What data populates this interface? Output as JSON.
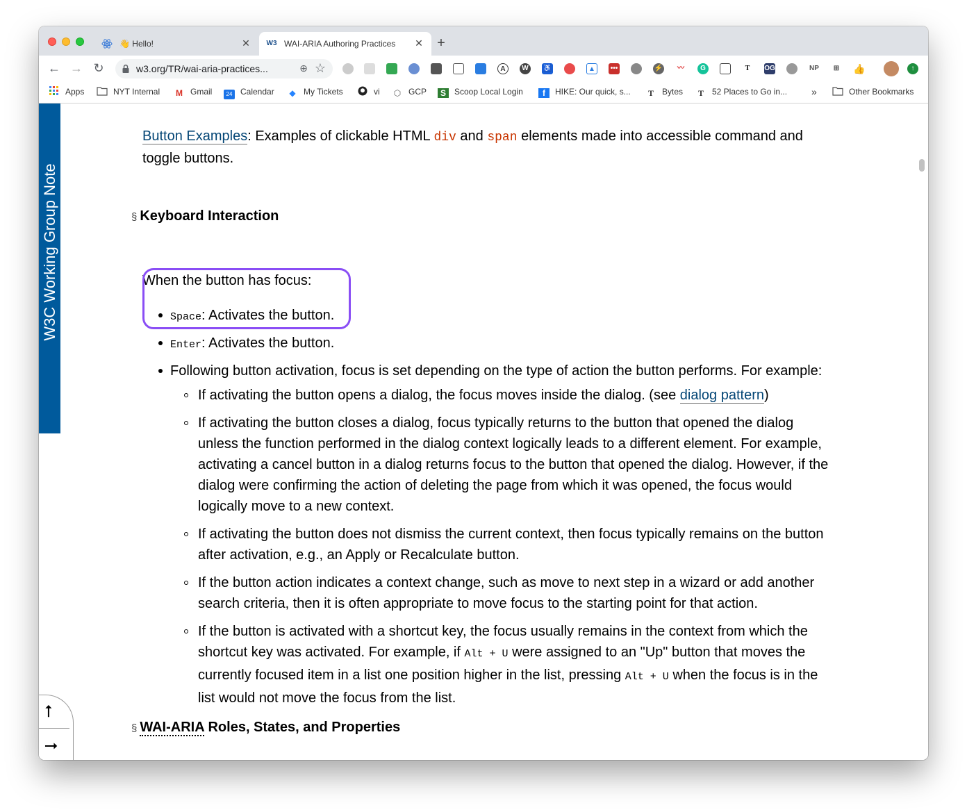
{
  "browser": {
    "tabs": [
      {
        "title": "👋 Hello!",
        "favicon": "react-atom-icon",
        "active": false
      },
      {
        "title": "WAI-ARIA Authoring Practices",
        "favicon": "w3c-icon",
        "active": true
      }
    ],
    "new_tab_label": "+",
    "url": "w3.org/TR/wai-aria-practices...",
    "bookmarks": [
      {
        "label": "Apps",
        "icon": "apps-grid-icon"
      },
      {
        "label": "NYT Internal",
        "icon": "folder-icon"
      },
      {
        "label": "Gmail",
        "icon": "gmail-icon"
      },
      {
        "label": "Calendar",
        "icon": "calendar-icon"
      },
      {
        "label": "My Tickets",
        "icon": "jira-icon"
      },
      {
        "label": "vi",
        "icon": "github-icon"
      },
      {
        "label": "GCP",
        "icon": "gcp-icon"
      },
      {
        "label": "Scoop Local Login",
        "icon": "scoop-icon"
      },
      {
        "label": "HIKE: Our quick, s...",
        "icon": "facebook-icon"
      },
      {
        "label": "Bytes",
        "icon": "nyt-icon"
      },
      {
        "label": "52 Places to Go in...",
        "icon": "nyt-icon"
      },
      {
        "label": "»",
        "icon": ""
      },
      {
        "label": "Other Bookmarks",
        "icon": "folder-icon"
      }
    ],
    "calendar_day": "24"
  },
  "page": {
    "banner": "W3C Working Group Note",
    "button_examples": {
      "link": "Button Examples",
      "text1": ": Examples of clickable HTML ",
      "code1": "div",
      "text2": " and ",
      "code2": "span",
      "text3": " elements made into accessible command and",
      "line2": "toggle buttons."
    },
    "keyboard_heading": "Keyboard Interaction",
    "section_mark": "§",
    "intro": "When the button has focus:",
    "items": [
      {
        "key": "Space",
        "text": ": Activates the button."
      },
      {
        "key": "Enter",
        "text": ": Activates the button."
      }
    ],
    "following": "Following button activation, focus is set depending on the type of action the button performs. For example:",
    "sub1": {
      "text": "If activating the button opens a dialog, the focus moves inside the dialog. (see ",
      "link": "dialog pattern",
      "end": ")"
    },
    "sub2": [
      "If activating the button closes a dialog, focus typically returns to the button that opened the dialog",
      "unless the function performed in the dialog context logically leads to a different element. For example,",
      "activating a cancel button in a dialog returns focus to the button that opened the dialog. However, if the",
      "dialog were confirming the action of deleting the page from which it was opened, the focus would",
      "logically move to a new context."
    ],
    "sub3": [
      "If activating the button does not dismiss the current context, then focus typically remains on the button",
      "after activation, e.g., an Apply or Recalculate button."
    ],
    "sub4": [
      "If the button action indicates a context change, such as move to next step in a wizard or add another",
      "search criteria, then it is often appropriate to move focus to the starting point for that action."
    ],
    "sub5": {
      "line1": "If the button is activated with a shortcut key, the focus usually remains in the context from which the",
      "line2a": "shortcut key was activated. For example, if ",
      "code_a": "Alt + U",
      "line2b": " were assigned to an \"Up\" button that moves the",
      "line3a": "currently focused item in a list one position higher in the list, pressing ",
      "code_b": "Alt + U",
      "line3b": " when the focus is in the",
      "line4": "list would not move the focus from the list."
    },
    "roles_heading_abbr": "WAI-ARIA",
    "roles_heading_rest": " Roles, States, and Properties"
  },
  "colors": {
    "banner": "#005a9c",
    "link": "#034575",
    "code_red": "#c83500",
    "highlight": "#8a4ef5"
  }
}
